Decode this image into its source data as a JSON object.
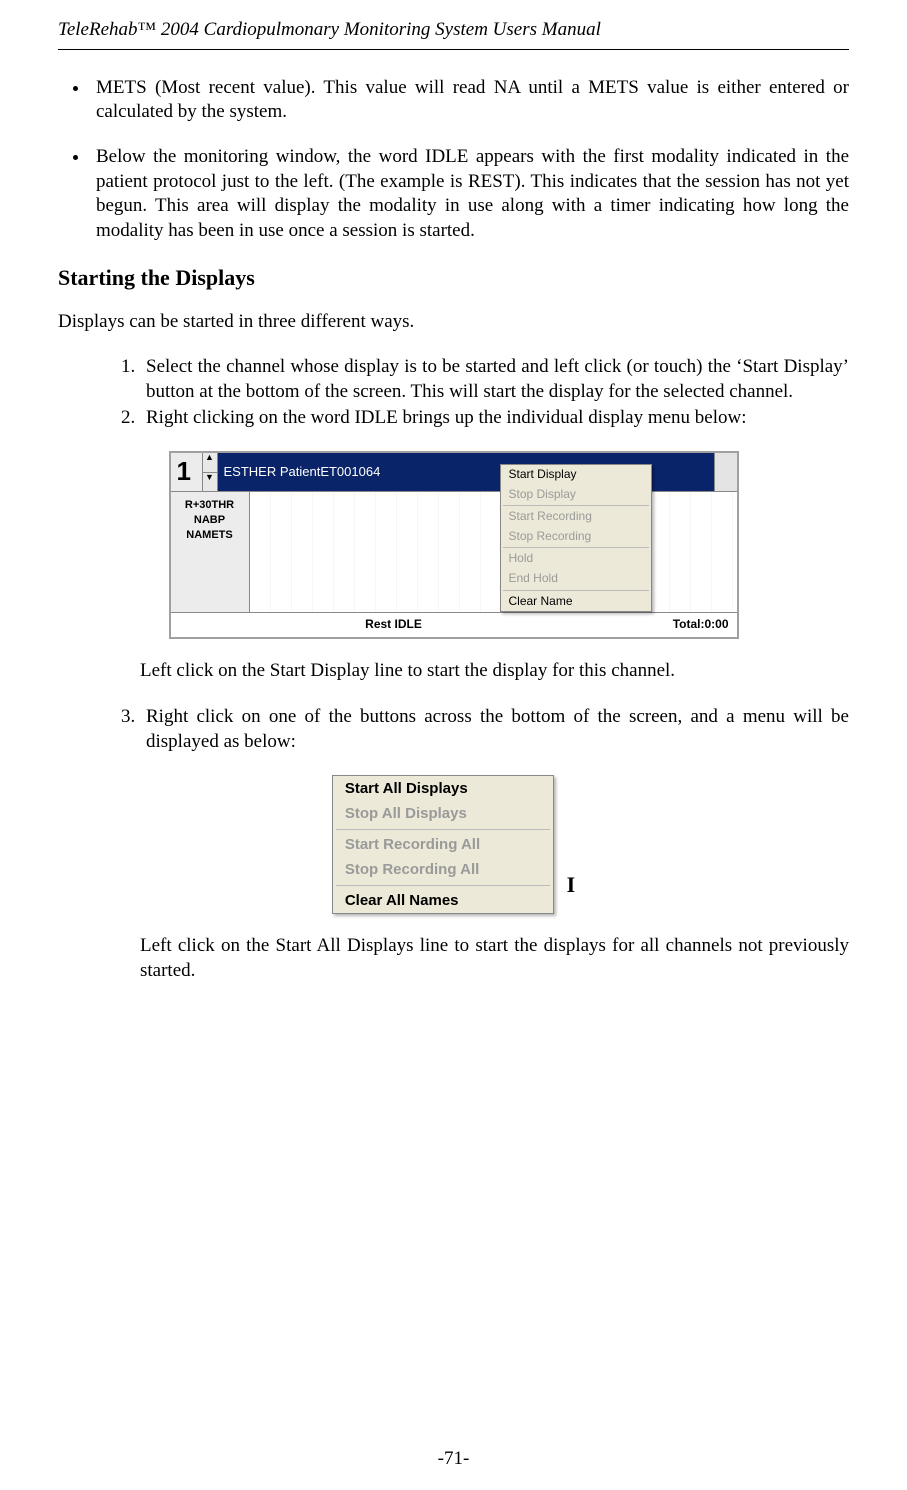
{
  "header": {
    "title_prefix": "TeleRehab",
    "title_tm": "™",
    "title_suffix": " 2004 Cardiopulmonary Monitoring System Users Manual"
  },
  "bullets": [
    "METS (Most recent value). This value will read NA until a METS value is either entered or calculated by the system.",
    "Below the monitoring window, the word IDLE appears with the first modality indicated in the patient protocol just to the left. (The example is REST). This indicates that the session has not yet begun. This area will display the modality in use along with a timer indicating how long the modality has been in use once a session is started."
  ],
  "section_title": "Starting the Displays",
  "intro": "Displays can be started in three different ways.",
  "numbered": [
    "Select the channel whose display is to be started and left click (or touch) the ‘Start Display’ button at the bottom of the screen. This will start the display for the selected channel.",
    "Right clicking on the word IDLE brings up the individual display menu below:"
  ],
  "after_fig1": "Left click on the Start Display line to start the display for this channel.",
  "numbered3": "Right click on one of the buttons across the bottom of the screen, and a menu will be displayed as below:",
  "after_fig2": "Left click on the Start All Displays line to start the displays for all channels not previously started.",
  "fig1": {
    "channel": "1",
    "spin_up": "▲",
    "spin_dn": "▼",
    "title": "ESTHER PatientET001064",
    "labels": {
      "l1": "R+30THR",
      "l2": "NABP",
      "l3": "NAMETS"
    },
    "menu": {
      "m1": "Start Display",
      "m2": "Stop Display",
      "m3": "Start Recording",
      "m4": "Stop Recording",
      "m5": "Hold",
      "m6": "End Hold",
      "m7": "Clear Name"
    },
    "bottom_left": "Rest   IDLE",
    "bottom_right": "Total:0:00"
  },
  "fig2": {
    "m1": "Start All Displays",
    "m2": "Stop All Displays",
    "m3": "Start Recording All",
    "m4": "Stop Recording All",
    "m5": "Clear All Names",
    "cursor": "I"
  },
  "page_num": "-71-"
}
